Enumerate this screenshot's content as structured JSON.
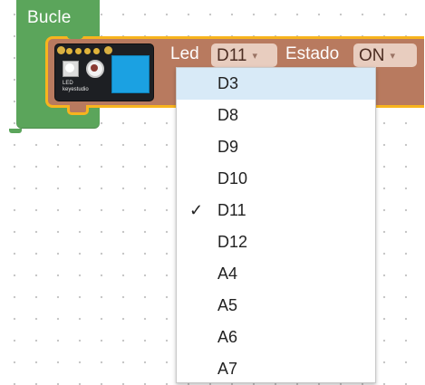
{
  "loop_block": {
    "label": "Bucle",
    "color": "#5ba55b"
  },
  "led_block": {
    "color": "#b87a5f",
    "border_color": "#f8b41e",
    "module_icon": "keyestudio-led-module-image",
    "module_text_line1": "LED",
    "module_text_line2": "keyestudio",
    "led_label": "Led",
    "pin_value": "D11",
    "state_label": "Estado",
    "state_value": "ON",
    "dropdown_arrow": "▾"
  },
  "pin_menu": {
    "options": [
      "D3",
      "D8",
      "D9",
      "D10",
      "D11",
      "D12",
      "A4",
      "A5",
      "A6",
      "A7"
    ],
    "selected": "D11",
    "highlighted": "D3",
    "check_mark": "✓"
  }
}
